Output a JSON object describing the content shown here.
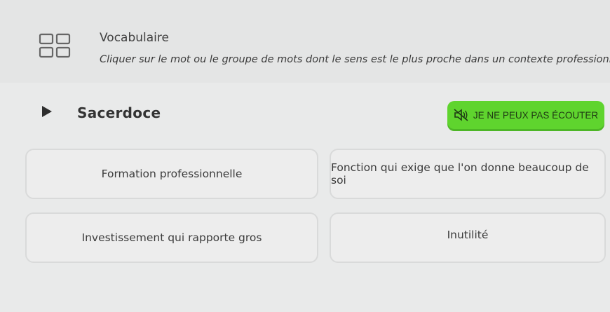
{
  "exercise": {
    "title": "Vocabulaire",
    "instructions": "Cliquer sur le mot ou le groupe de mots dont le sens est le plus proche dans un contexte professionnel."
  },
  "prompt": {
    "word": "Sacerdoce"
  },
  "cant_listen_button": {
    "label": "JE NE PEUX PAS ÉCOUTER",
    "color": "#5fd42e"
  },
  "options": [
    {
      "label": "Formation professionnelle"
    },
    {
      "label": "Fonction qui exige que l'on donne beaucoup de soi"
    },
    {
      "label": "Investissement qui rapporte gros"
    },
    {
      "label": "Inutilité"
    }
  ],
  "icons": {
    "exercise": "grid-icon",
    "play": "play-icon",
    "sound_off": "speaker-muted-icon"
  }
}
